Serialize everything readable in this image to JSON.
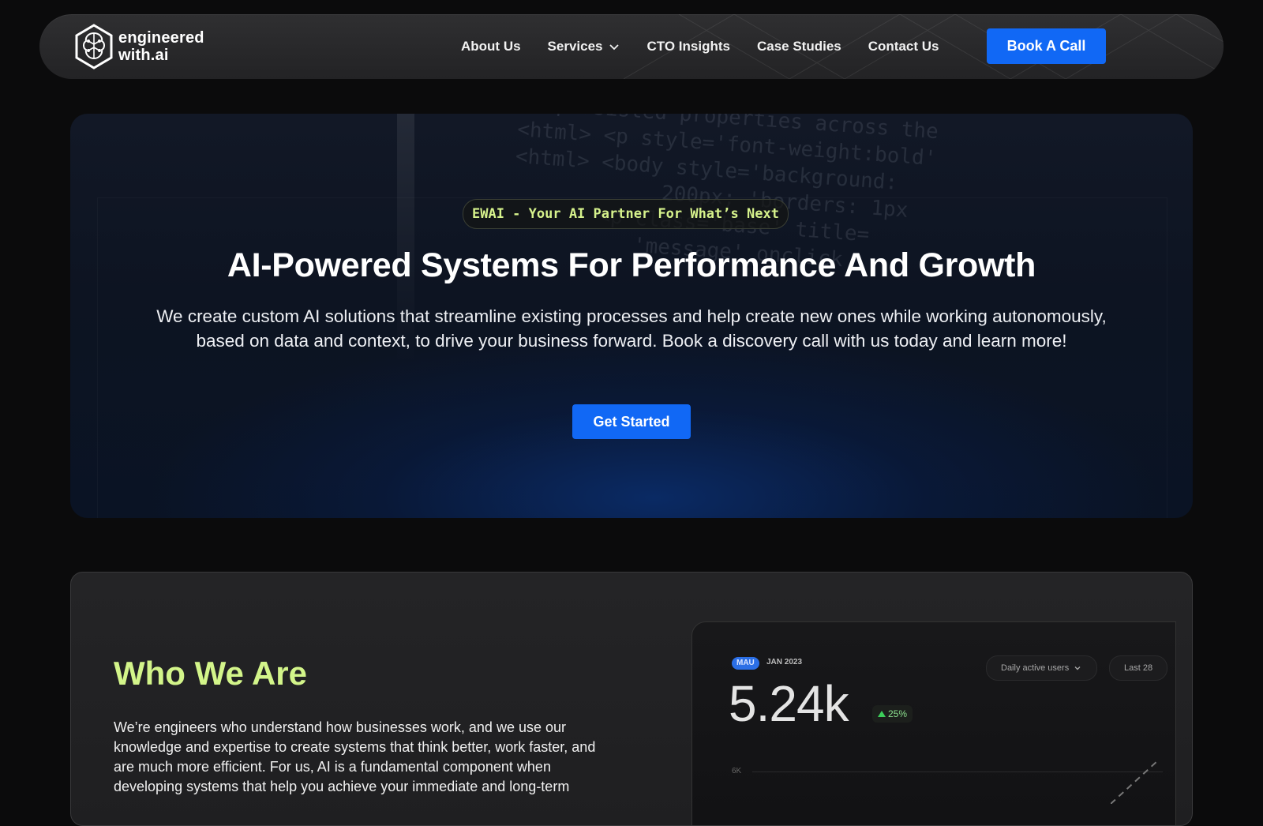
{
  "nav": {
    "logo_line1": "engineered",
    "logo_line2": "with.ai",
    "items": [
      {
        "label": "About Us"
      },
      {
        "label": "Services"
      },
      {
        "label": "CTO Insights"
      },
      {
        "label": "Case Studies"
      },
      {
        "label": "Contact Us"
      }
    ],
    "cta_label": "Book A Call"
  },
  "hero": {
    "badge": "EWAI - Your AI Partner For What’s Next",
    "title": "AI-Powered Systems For Performance And Growth",
    "description": "We create custom AI solutions that streamline existing processes and help create new ones while working autonomously, based on data and context, to drive your business forward. Book a discovery call with us today and learn more!",
    "cta_label": "Get Started",
    "code_lines": "// persisted properties across the\n<html> <p style='font-weight:bold'\n<html> <body style='background:\n            200px; 'borders: 1px\n       <p class='base' title=\n          'message' onclick"
  },
  "who": {
    "title": "Who We Are",
    "text": "We’re engineers who understand how businesses work, and we use our knowledge and expertise to create systems that think better, work faster, and are much more efficient. For us, AI is a fundamental component when developing systems that help you achieve your immediate and long-term"
  },
  "dashboard": {
    "pill": "MAU",
    "date": "JAN 2023",
    "metric": "5.24k",
    "delta": "25%",
    "select_metric": "Daily active users",
    "select_range": "Last 28",
    "ytick": "6K"
  },
  "colors": {
    "accent": "#1168f5",
    "headline_green": "#d3f58a",
    "badge_text": "#d6f28c"
  }
}
